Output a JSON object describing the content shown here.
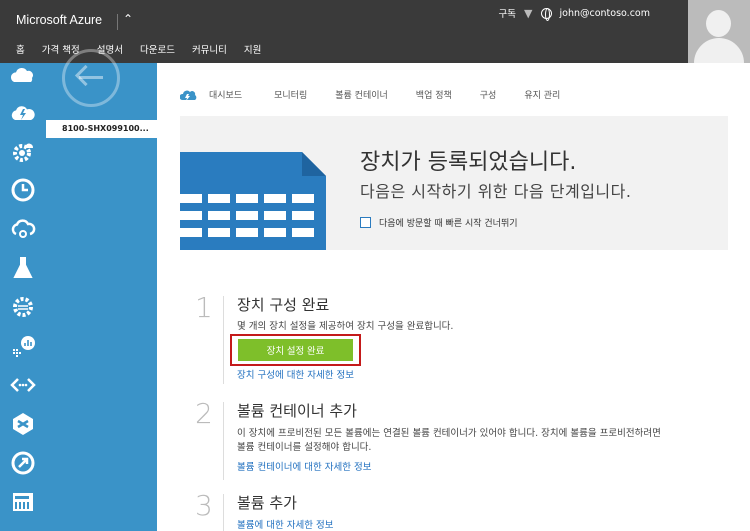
{
  "app": {
    "title": "Microsoft Azure",
    "nav": [
      "홈",
      "가격 책정",
      "설명서",
      "다운로드",
      "커뮤니티",
      "지원"
    ],
    "subscription_label": "구독",
    "user_email": "john@contoso.com"
  },
  "leftbar": {
    "icons": [
      "cloud-services-icon",
      "cloud-lightning-icon",
      "gear-cloud-icon",
      "clock-icon",
      "cloud-sync-icon",
      "flask-icon",
      "gear-waves-icon",
      "chart-icon",
      "code-arrows-icon",
      "cube-icon",
      "arrow-circle-icon",
      "storage-device-icon"
    ]
  },
  "sidepanel": {
    "device_name": "8100-SHX099100..."
  },
  "tabs": [
    "대시보드",
    "모니터링",
    "볼륨 컨테이너",
    "백업 정책",
    "구성",
    "유지 관리"
  ],
  "hero": {
    "title": "장치가 등록되었습니다.",
    "subtitle": "다음은 시작하기 위한 다음 단계입니다.",
    "skip_label": "다음에 방문할 때 빠른 시작 건너뛰기"
  },
  "steps": [
    {
      "number": "1",
      "title": "장치 구성 완료",
      "description": "몇 개의 장치 설정을 제공하여 장치 구성을 완료합니다.",
      "button": "장치 설정 완료",
      "link": "장치 구성에 대한 자세한 정보"
    },
    {
      "number": "2",
      "title": "볼륨 컨테이너 추가",
      "description": "이 장치에 프로비전된 모든 볼륨에는 연결된 볼륨 컨테이너가 있어야 합니다. 장치에 볼륨을 프로비전하려면 볼륨 컨테이너를 설정해야 합니다.",
      "link": "볼륨 컨테이너에 대한 자세한 정보"
    },
    {
      "number": "3",
      "title": "볼륨 추가",
      "link": "볼륨에 대한 자세한 정보"
    }
  ],
  "colors": {
    "topbar": "#3a3a3a",
    "sidebar": "#3a93c8",
    "accent_button": "#7ebf2a",
    "highlight_border": "#c41a1a",
    "link": "#1f6fbf"
  }
}
